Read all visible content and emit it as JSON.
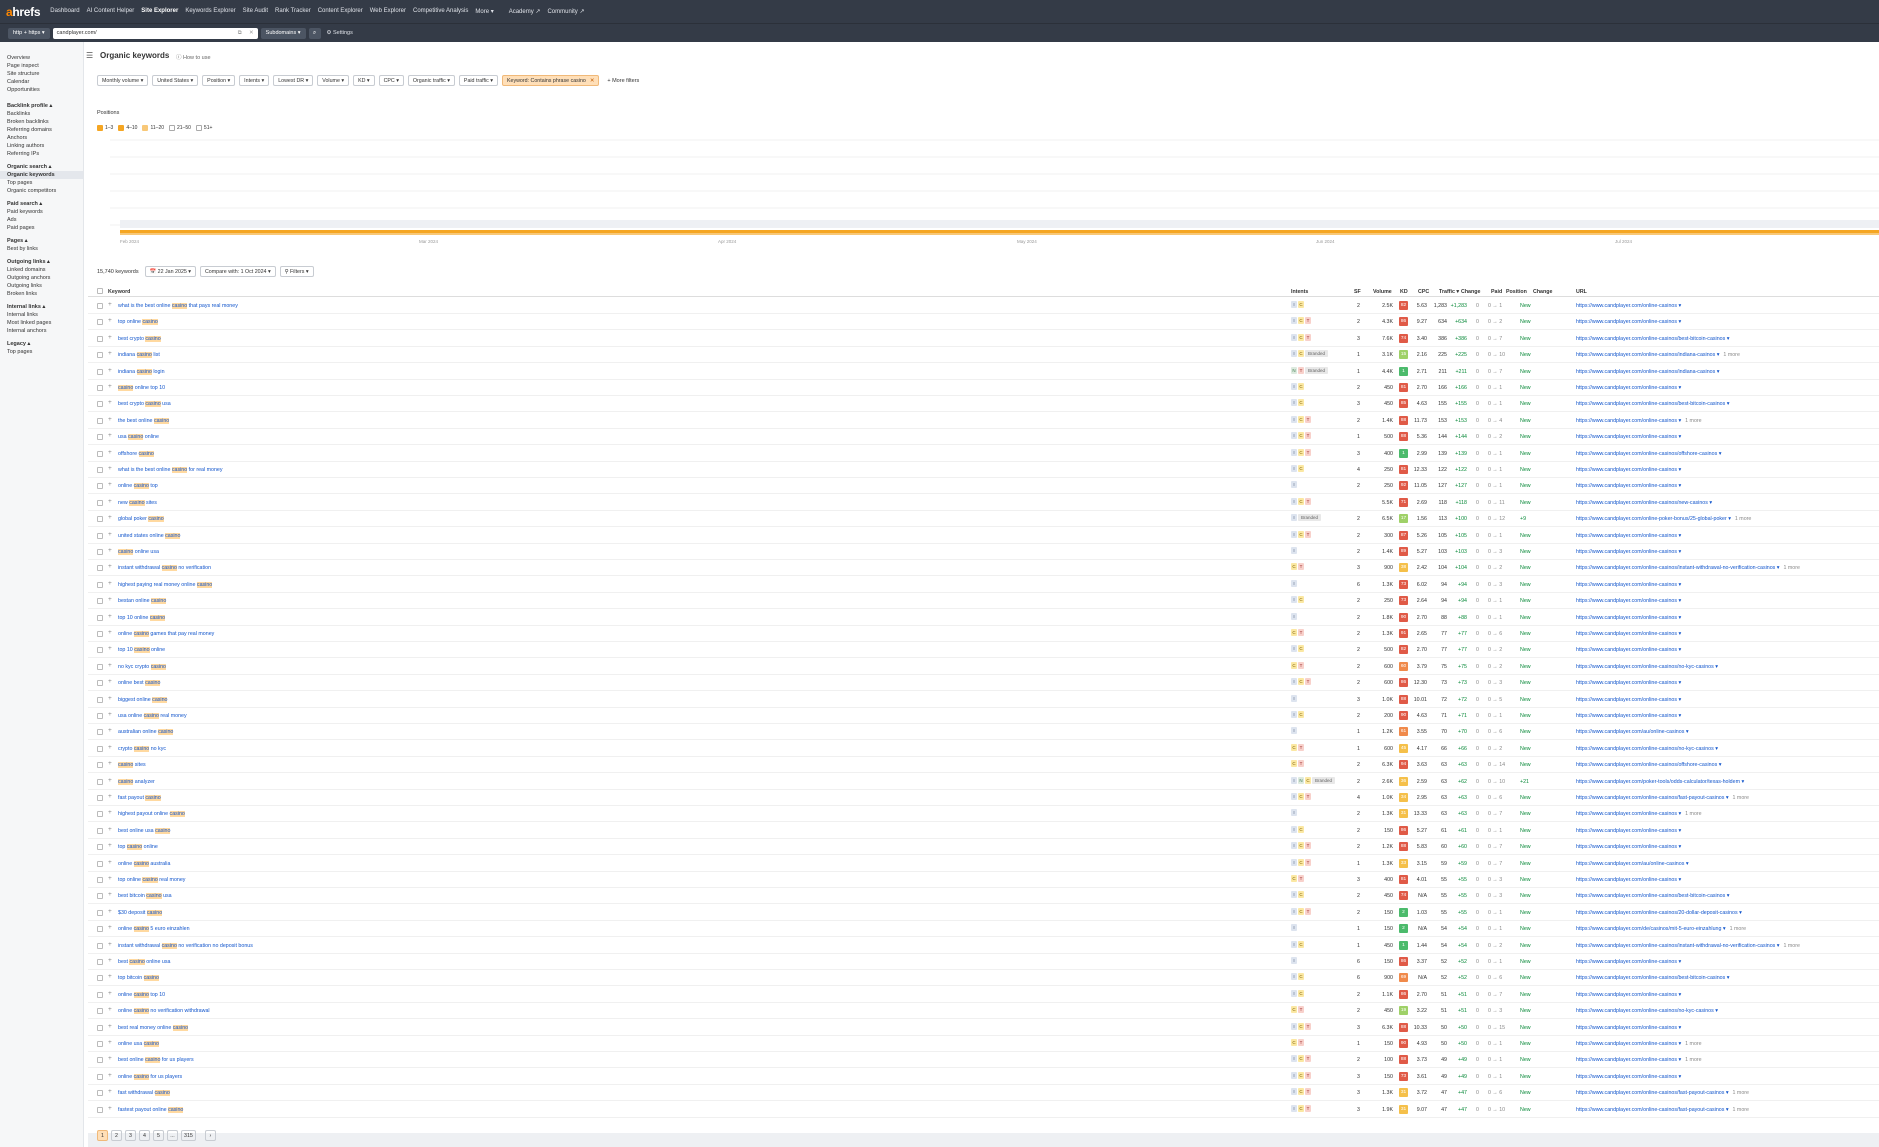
{
  "topnav": {
    "logo_a": "a",
    "logo_rest": "hrefs",
    "items": [
      "Dashboard",
      "AI Content Helper",
      "Site Explorer",
      "Keywords Explorer",
      "Site Audit",
      "Rank Tracker",
      "Content Explorer",
      "Web Explorer",
      "Competitive Analysis",
      "More ▾",
      "Academy ↗",
      "Community ↗"
    ],
    "active": 2
  },
  "subbar": {
    "protocol": "http + https ▾",
    "url": "candplayer.com/",
    "mode": "Subdomains ▾",
    "settings": "⚙ Settings"
  },
  "sidebar": [
    {
      "head": "",
      "items": [
        "Overview",
        "Page inspect",
        "Site structure",
        "Calendar",
        "Opportunities"
      ]
    },
    {
      "head": "Backlink profile ▴",
      "items": [
        "Backlinks",
        "Broken backlinks",
        "Referring domains",
        "Anchors",
        "Linking authors",
        "Referring IPs"
      ]
    },
    {
      "head": "Organic search ▴",
      "items": [
        "Organic keywords",
        "Top pages",
        "Organic competitors"
      ],
      "active": 0
    },
    {
      "head": "Paid search ▴",
      "items": [
        "Paid keywords",
        "Ads",
        "Paid pages"
      ]
    },
    {
      "head": "Pages ▴",
      "items": [
        "Best by links"
      ]
    },
    {
      "head": "Outgoing links ▴",
      "items": [
        "Linked domains",
        "Outgoing anchors",
        "Outgoing links",
        "Broken links"
      ]
    },
    {
      "head": "Internal links ▴",
      "items": [
        "Internal links",
        "Most linked pages",
        "Internal anchors"
      ]
    },
    {
      "head": "Legacy ▴",
      "items": [
        "Top pages"
      ]
    }
  ],
  "page": {
    "title": "Organic keywords",
    "howto": "How to use"
  },
  "filters": {
    "items": [
      "Monthly volume ▾",
      "United States ▾",
      "Position ▾",
      "Intents ▾",
      "Lowest DR ▾",
      "Volume ▾",
      "KD ▾",
      "CPC ▾",
      "Organic traffic ▾",
      "Paid traffic ▾"
    ],
    "active": "Keyword: Contains phrase casino",
    "more": "More filters"
  },
  "chart": {
    "title": "Positions",
    "legend": [
      {
        "label": "1–3",
        "color": "#f5a623",
        "checked": true
      },
      {
        "label": "4–10",
        "color": "#f5a623",
        "checked": true
      },
      {
        "label": "11–20",
        "color": "#f8c878",
        "checked": true
      },
      {
        "label": "21–50",
        "color": "#ddd",
        "checked": false
      },
      {
        "label": "51+",
        "color": "#eee",
        "checked": false
      }
    ],
    "xticks": [
      "Feb 2024",
      "Mar 2024",
      "Apr 2024",
      "May 2024",
      "Jun 2024",
      "Jul 2024"
    ]
  },
  "table": {
    "count": "15,740 keywords",
    "date": "22 Jan 2025 ▾",
    "compare": "Compare with: 1 Oct 2024 ▾",
    "filters": "Filters ▾",
    "headers": {
      "keyword": "Keyword",
      "intents": "Intents",
      "sf": "SF",
      "volume": "Volume",
      "kd": "KD",
      "cpc": "CPC",
      "traffic": "Traffic ▾",
      "change": "Change",
      "paid": "Paid",
      "position": "Position",
      "pchange": "Change",
      "url": "URL"
    },
    "rows": [
      [
        "what is the best online casino that pays real money",
        "IC",
        "2",
        "2.5K",
        82,
        "5.63",
        "1,283",
        "+1,283",
        "1",
        "New",
        "https://www.candplayer.com/online-casinos ▾",
        ""
      ],
      [
        "top online casino",
        "ICT",
        "2",
        "4.3K",
        86,
        "9.27",
        "634",
        "+634",
        "2",
        "New",
        "https://www.candplayer.com/online-casinos ▾",
        ""
      ],
      [
        "best crypto casino",
        "ICT",
        "3",
        "7.6K",
        74,
        "3.40",
        "386",
        "+386",
        "7",
        "New",
        "https://www.candplayer.com/online-casinos/best-bitcoin-casinos ▾",
        ""
      ],
      [
        "indiana casino list",
        "ICB",
        "1",
        "3.1K",
        15,
        "2.16",
        "225",
        "+225",
        "10",
        "New",
        "https://www.candplayer.com/online-casinos/indiana-casinos ▾",
        "1 more"
      ],
      [
        "indiana casino login",
        "NTB",
        "1",
        "4.4K",
        1,
        "2.71",
        "211",
        "+211",
        "7",
        "New",
        "https://www.candplayer.com/online-casinos/indiana-casinos ▾",
        ""
      ],
      [
        "casino online top 10",
        "IC",
        "2",
        "450",
        81,
        "2.70",
        "166",
        "+166",
        "1",
        "New",
        "https://www.candplayer.com/online-casinos ▾",
        ""
      ],
      [
        "best crypto casino usa",
        "IC",
        "3",
        "450",
        85,
        "4.63",
        "155",
        "+155",
        "1",
        "New",
        "https://www.candplayer.com/online-casinos/best-bitcoin-casinos ▾",
        ""
      ],
      [
        "the best online casino",
        "ICT",
        "2",
        "1.4K",
        88,
        "11.73",
        "153",
        "+153",
        "4",
        "New",
        "https://www.candplayer.com/online-casinos ▾",
        "1 more"
      ],
      [
        "usa casino online",
        "ICT",
        "1",
        "500",
        88,
        "5.36",
        "144",
        "+144",
        "2",
        "New",
        "https://www.candplayer.com/online-casinos ▾",
        ""
      ],
      [
        "offshore casino",
        "ICT",
        "3",
        "400",
        1,
        "2.99",
        "139",
        "+139",
        "1",
        "New",
        "https://www.candplayer.com/online-casinos/offshore-casinos ▾",
        ""
      ],
      [
        "what is the best online casino for real money",
        "IC",
        "4",
        "250",
        81,
        "12.33",
        "122",
        "+122",
        "1",
        "New",
        "https://www.candplayer.com/online-casinos ▾",
        ""
      ],
      [
        "online casino top",
        "I",
        "2",
        "250",
        92,
        "11.05",
        "127",
        "+127",
        "1",
        "New",
        "https://www.candplayer.com/online-casinos ▾",
        ""
      ],
      [
        "new casino sites",
        "ICT",
        "",
        "5.5K",
        71,
        "2.69",
        "118",
        "+118",
        "11",
        "New",
        "https://www.candplayer.com/online-casinos/new-casinos ▾",
        ""
      ],
      [
        "global poker casino",
        "IB",
        "2",
        "6.5K",
        17,
        "1.56",
        "113",
        "+100",
        "12",
        "+9",
        "https://www.candplayer.com/online-poker-bonus/25-global-poker ▾",
        "1 more"
      ],
      [
        "united states online casino",
        "ICT",
        "2",
        "300",
        87,
        "5.26",
        "105",
        "+105",
        "1",
        "New",
        "https://www.candplayer.com/online-casinos ▾",
        ""
      ],
      [
        "casino online usa",
        "I",
        "2",
        "1.4K",
        89,
        "5.27",
        "103",
        "+103",
        "3",
        "New",
        "https://www.candplayer.com/online-casinos ▾",
        ""
      ],
      [
        "instant withdrawal casino no verification",
        "CT",
        "3",
        "900",
        38,
        "2.42",
        "104",
        "+104",
        "2",
        "New",
        "https://www.candplayer.com/online-casinos/instant-withdrawal-no-verification-casinos ▾",
        "1 more"
      ],
      [
        "highest paying real money online casino",
        "I",
        "6",
        "1.3K",
        73,
        "6.02",
        "94",
        "+94",
        "3",
        "New",
        "https://www.candplayer.com/online-casinos ▾",
        ""
      ],
      [
        "bestan online casino",
        "IC",
        "2",
        "250",
        73,
        "2.64",
        "94",
        "+94",
        "1",
        "New",
        "https://www.candplayer.com/online-casinos ▾",
        ""
      ],
      [
        "top 10 online casino",
        "I",
        "2",
        "1.8K",
        90,
        "2.70",
        "88",
        "+88",
        "1",
        "New",
        "https://www.candplayer.com/online-casinos ▾",
        ""
      ],
      [
        "online casino games that pay real money",
        "CT",
        "2",
        "1.3K",
        91,
        "2.65",
        "77",
        "+77",
        "6",
        "New",
        "https://www.candplayer.com/online-casinos ▾",
        ""
      ],
      [
        "top 10 casino online",
        "IC",
        "2",
        "500",
        82,
        "2.70",
        "77",
        "+77",
        "2",
        "New",
        "https://www.candplayer.com/online-casinos ▾",
        ""
      ],
      [
        "no kyc crypto casino",
        "CT",
        "2",
        "600",
        60,
        "3.79",
        "75",
        "+75",
        "2",
        "New",
        "https://www.candplayer.com/online-casinos/no-kyc-casinos ▾",
        ""
      ],
      [
        "online best casino",
        "ICT",
        "2",
        "600",
        86,
        "12.30",
        "73",
        "+73",
        "3",
        "New",
        "https://www.candplayer.com/online-casinos ▾",
        ""
      ],
      [
        "biggest online casino",
        "I",
        "3",
        "1.0K",
        88,
        "10.01",
        "72",
        "+72",
        "5",
        "New",
        "https://www.candplayer.com/online-casinos ▾",
        ""
      ],
      [
        "usa online casino real money",
        "IC",
        "2",
        "200",
        90,
        "4.63",
        "71",
        "+71",
        "1",
        "New",
        "https://www.candplayer.com/online-casinos ▾",
        ""
      ],
      [
        "australian online casino",
        "I",
        "1",
        "1.2K",
        61,
        "3.55",
        "70",
        "+70",
        "6",
        "New",
        "https://www.candplayer.com/au/online-casinos ▾",
        ""
      ],
      [
        "crypto casino no kyc",
        "CT",
        "1",
        "600",
        45,
        "4.17",
        "66",
        "+66",
        "2",
        "New",
        "https://www.candplayer.com/online-casinos/no-kyc-casinos ▾",
        ""
      ],
      [
        "casino sites",
        "CT",
        "2",
        "6.3K",
        94,
        "3.63",
        "63",
        "+63",
        "14",
        "New",
        "https://www.candplayer.com/online-casinos/offshore-casinos ▾",
        ""
      ],
      [
        "casino analyzer",
        "INCB",
        "2",
        "2.6K",
        36,
        "2.59",
        "63",
        "+62",
        "10",
        "+21",
        "https://www.candplayer.com/poker-tools/odds-calculator/texas-holdem ▾",
        ""
      ],
      [
        "fast payout casino",
        "ICT",
        "4",
        "1.0K",
        34,
        "2.95",
        "63",
        "+63",
        "6",
        "New",
        "https://www.candplayer.com/online-casinos/fast-payout-casinos ▾",
        "1 more"
      ],
      [
        "highest payout online casino",
        "I",
        "2",
        "1.3K",
        31,
        "13.33",
        "63",
        "+63",
        "7",
        "New",
        "https://www.candplayer.com/online-casinos ▾",
        "1 more"
      ],
      [
        "best online usa casino",
        "IC",
        "2",
        "150",
        86,
        "5.27",
        "61",
        "+61",
        "1",
        "New",
        "https://www.candplayer.com/online-casinos ▾",
        ""
      ],
      [
        "top casino online",
        "ICT",
        "2",
        "1.2K",
        88,
        "5.83",
        "60",
        "+60",
        "7",
        "New",
        "https://www.candplayer.com/online-casinos ▾",
        ""
      ],
      [
        "online casino australia",
        "ICT",
        "1",
        "1.3K",
        33,
        "3.15",
        "59",
        "+59",
        "7",
        "New",
        "https://www.candplayer.com/au/online-casinos ▾",
        ""
      ],
      [
        "top online casino real money",
        "CT",
        "3",
        "400",
        81,
        "4.01",
        "55",
        "+55",
        "3",
        "New",
        "https://www.candplayer.com/online-casinos ▾",
        ""
      ],
      [
        "best bitcoin casino usa",
        "IC",
        "2",
        "450",
        74,
        "N/A",
        "55",
        "+55",
        "3",
        "New",
        "https://www.candplayer.com/online-casinos/best-bitcoin-casinos ▾",
        ""
      ],
      [
        "$30 deposit casino",
        "ICT",
        "2",
        "150",
        2,
        "1.03",
        "55",
        "+55",
        "1",
        "New",
        "https://www.candplayer.com/online-casinos/20-dollar-deposit-casinos ▾",
        ""
      ],
      [
        "online casino 5 euro einzahlen",
        "I",
        "1",
        "150",
        2,
        "N/A",
        "54",
        "+54",
        "1",
        "New",
        "https://www.candplayer.com/de/casinos/mit-5-euro-einzahlung ▾",
        "1 more"
      ],
      [
        "instant withdrawal casino no verification no deposit bonus",
        "IC",
        "1",
        "450",
        1,
        "1.44",
        "54",
        "+54",
        "2",
        "New",
        "https://www.candplayer.com/online-casinos/instant-withdrawal-no-verification-casinos ▾",
        "1 more"
      ],
      [
        "best casino online usa",
        "I",
        "6",
        "150",
        86,
        "3.37",
        "52",
        "+52",
        "1",
        "New",
        "https://www.candplayer.com/online-casinos ▾",
        ""
      ],
      [
        "top bitcoin casino",
        "IC",
        "6",
        "900",
        69,
        "N/A",
        "52",
        "+52",
        "6",
        "New",
        "https://www.candplayer.com/online-casinos/best-bitcoin-casinos ▾",
        ""
      ],
      [
        "online casino top 10",
        "IC",
        "2",
        "1.1K",
        86,
        "2.70",
        "51",
        "+51",
        "7",
        "New",
        "https://www.candplayer.com/online-casinos ▾",
        ""
      ],
      [
        "online casino no verification withdrawal",
        "CT",
        "2",
        "450",
        19,
        "3.22",
        "51",
        "+51",
        "3",
        "New",
        "https://www.candplayer.com/online-casinos/no-kyc-casinos ▾",
        ""
      ],
      [
        "best real money online casino",
        "ICT",
        "3",
        "6.3K",
        88,
        "10.33",
        "50",
        "+50",
        "15",
        "New",
        "https://www.candplayer.com/online-casinos ▾",
        ""
      ],
      [
        "online usa casino",
        "CT",
        "1",
        "150",
        90,
        "4.93",
        "50",
        "+50",
        "1",
        "New",
        "https://www.candplayer.com/online-casinos ▾",
        "1 more"
      ],
      [
        "best online casino for us players",
        "ICT",
        "2",
        "100",
        88,
        "3.73",
        "49",
        "+49",
        "1",
        "New",
        "https://www.candplayer.com/online-casinos ▾",
        "1 more"
      ],
      [
        "online casino for us players",
        "ICT",
        "3",
        "150",
        73,
        "3.61",
        "49",
        "+49",
        "1",
        "New",
        "https://www.candplayer.com/online-casinos ▾",
        ""
      ],
      [
        "fast withdrawal casino",
        "ICT",
        "3",
        "1.3K",
        31,
        "3.72",
        "47",
        "+47",
        "6",
        "New",
        "https://www.candplayer.com/online-casinos/fast-payout-casinos ▾",
        "1 more"
      ],
      [
        "fastest payout online casino",
        "ICT",
        "3",
        "1.9K",
        31,
        "9.07",
        "47",
        "+47",
        "10",
        "New",
        "https://www.candplayer.com/online-casinos/fast-payout-casinos ▾",
        "1 more"
      ]
    ]
  },
  "pager": [
    "1",
    "2",
    "3",
    "4",
    "5",
    "...",
    "315",
    "›"
  ],
  "colors": {
    "nav": "#343b47",
    "accent": "#ff8800",
    "kd_red": "#d9534f",
    "kd_orange": "#f0ad4e",
    "kd_green": "#5cb85c"
  }
}
